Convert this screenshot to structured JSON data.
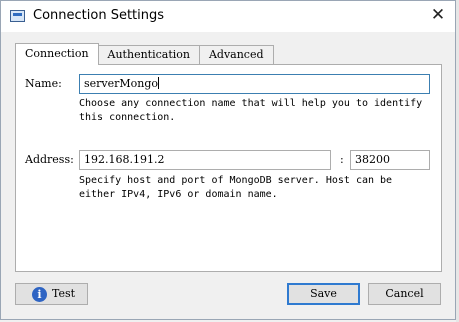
{
  "window": {
    "title": "Connection Settings",
    "close_glyph": "✕",
    "icon": "window-app-icon"
  },
  "tabs": [
    {
      "label": "Connection",
      "active": true
    },
    {
      "label": "Authentication",
      "active": false
    },
    {
      "label": "Advanced",
      "active": false
    }
  ],
  "connection": {
    "name_label": "Name:",
    "name_value": "serverMongo",
    "name_hint": "Choose any connection name that will help you to identify this connection.",
    "address_label": "Address:",
    "host_value": "192.168.191.2",
    "port_separator": ":",
    "port_value": "38200",
    "address_hint": "Specify host and port of MongoDB server. Host can be either IPv4, IPv6 or domain name."
  },
  "buttons": {
    "test_label": "Test",
    "test_icon": "info-icon",
    "save_label": "Save",
    "cancel_label": "Cancel"
  },
  "colors": {
    "focus_border": "#3c7fb1",
    "default_button_border": "#2f7ad0",
    "info_icon": "#2e64c3"
  }
}
